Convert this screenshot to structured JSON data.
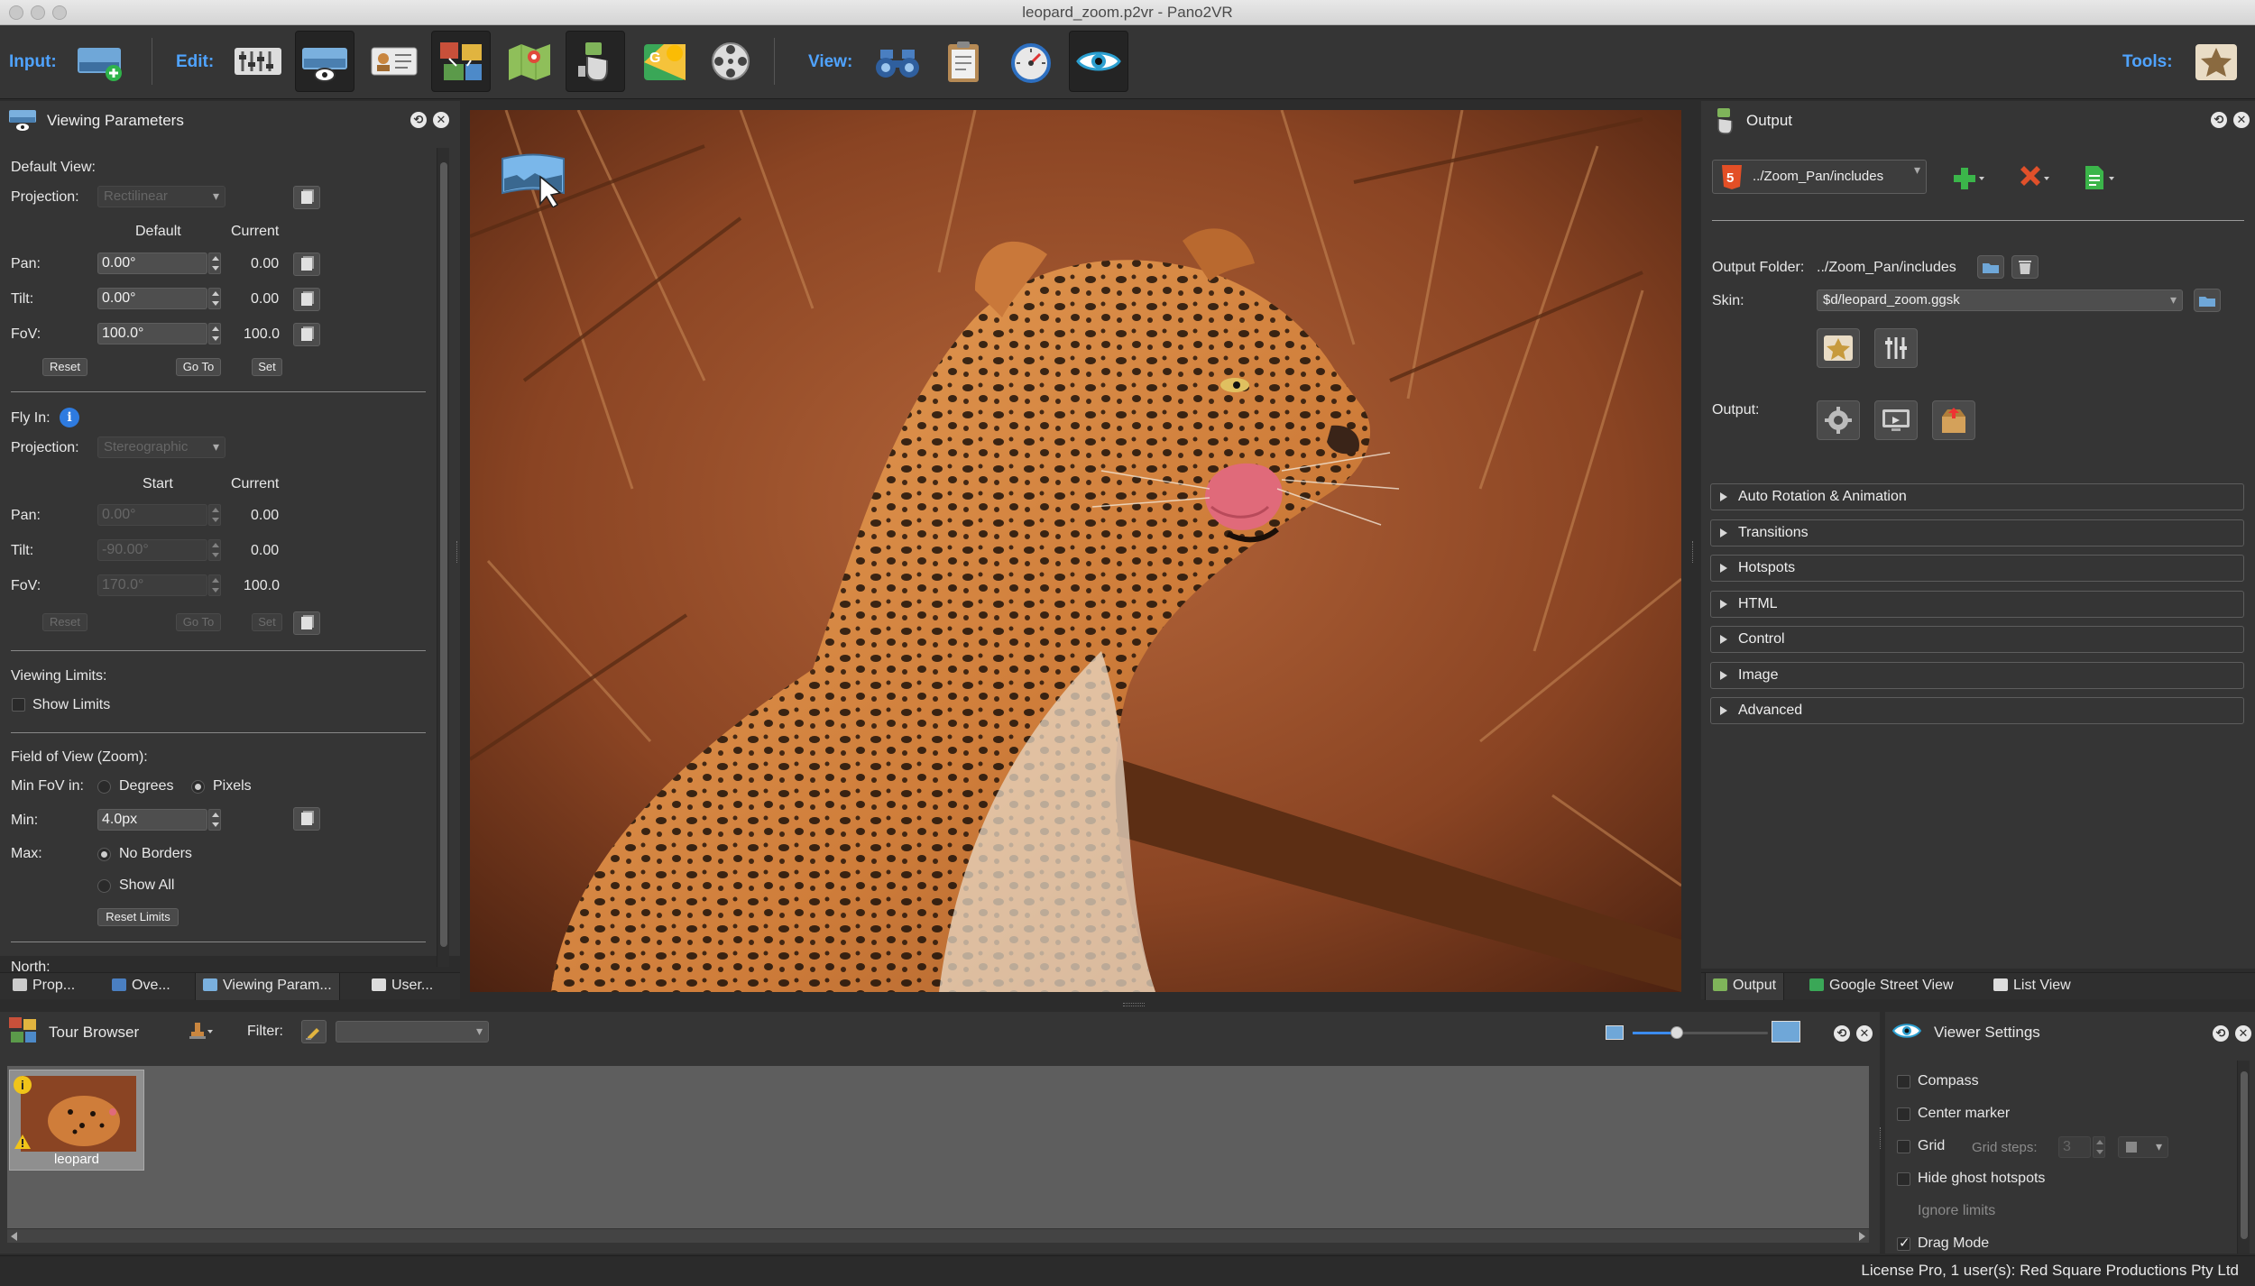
{
  "window": {
    "title": "leopard_zoom.p2vr - Pano2VR"
  },
  "toolbar": {
    "input_label": "Input:",
    "edit_label": "Edit:",
    "view_label": "View:",
    "tools_label": "Tools:"
  },
  "viewing_params": {
    "title": "Viewing Parameters",
    "default_view": {
      "heading": "Default View:",
      "projection_label": "Projection:",
      "projection_value": "Rectilinear",
      "col_default": "Default",
      "col_current": "Current",
      "rows": [
        {
          "label": "Pan:",
          "value": "0.00°",
          "current": "0.00"
        },
        {
          "label": "Tilt:",
          "value": "0.00°",
          "current": "0.00"
        },
        {
          "label": "FoV:",
          "value": "100.0°",
          "current": "100.0"
        }
      ],
      "reset": "Reset",
      "goto": "Go To",
      "set": "Set"
    },
    "fly_in": {
      "heading": "Fly In:",
      "projection_label": "Projection:",
      "projection_value": "Stereographic",
      "col_start": "Start",
      "col_current": "Current",
      "rows": [
        {
          "label": "Pan:",
          "value": "0.00°",
          "current": "0.00"
        },
        {
          "label": "Tilt:",
          "value": "-90.00°",
          "current": "0.00"
        },
        {
          "label": "FoV:",
          "value": "170.0°",
          "current": "100.0"
        }
      ],
      "reset": "Reset",
      "goto": "Go To",
      "set": "Set"
    },
    "limits": {
      "heading": "Viewing Limits:",
      "show_limits": "Show Limits"
    },
    "fov_zoom": {
      "heading": "Field of View (Zoom):",
      "min_fov_in": "Min FoV in:",
      "degrees": "Degrees",
      "pixels": "Pixels",
      "min_label": "Min:",
      "min_value": "4.0px",
      "max_label": "Max:",
      "no_borders": "No Borders",
      "show_all": "Show All",
      "reset_limits": "Reset Limits"
    },
    "north_label": "North:"
  },
  "left_tabs": [
    "Prop...",
    "Ove...",
    "Viewing Param...",
    "User..."
  ],
  "output": {
    "title": "Output",
    "target": "../Zoom_Pan/includes",
    "folder_label": "Output Folder:",
    "folder_value": "../Zoom_Pan/includes",
    "skin_label": "Skin:",
    "skin_value": "$d/leopard_zoom.ggsk",
    "output_label": "Output:",
    "sections": [
      "Auto Rotation & Animation",
      "Transitions",
      "Hotspots",
      "HTML",
      "Control",
      "Image",
      "Advanced"
    ]
  },
  "right_tabs": [
    "Output",
    "Google Street View",
    "List View"
  ],
  "tour_browser": {
    "title": "Tour Browser",
    "filter_label": "Filter:",
    "filter_value": "",
    "thumb_label": "leopard"
  },
  "viewer_settings": {
    "title": "Viewer Settings",
    "compass": "Compass",
    "center_marker": "Center marker",
    "grid": "Grid",
    "grid_steps_label": "Grid steps:",
    "grid_steps_value": "3",
    "hide_ghost": "Hide ghost hotspots",
    "ignore_limits": "Ignore limits",
    "drag_mode": "Drag Mode"
  },
  "status": {
    "license": "License Pro, 1 user(s): Red Square Productions Pty Ltd"
  },
  "colors": {
    "accent": "#4fa3ff",
    "panel": "#353535",
    "viewer_bg": "#1a1a1a"
  }
}
